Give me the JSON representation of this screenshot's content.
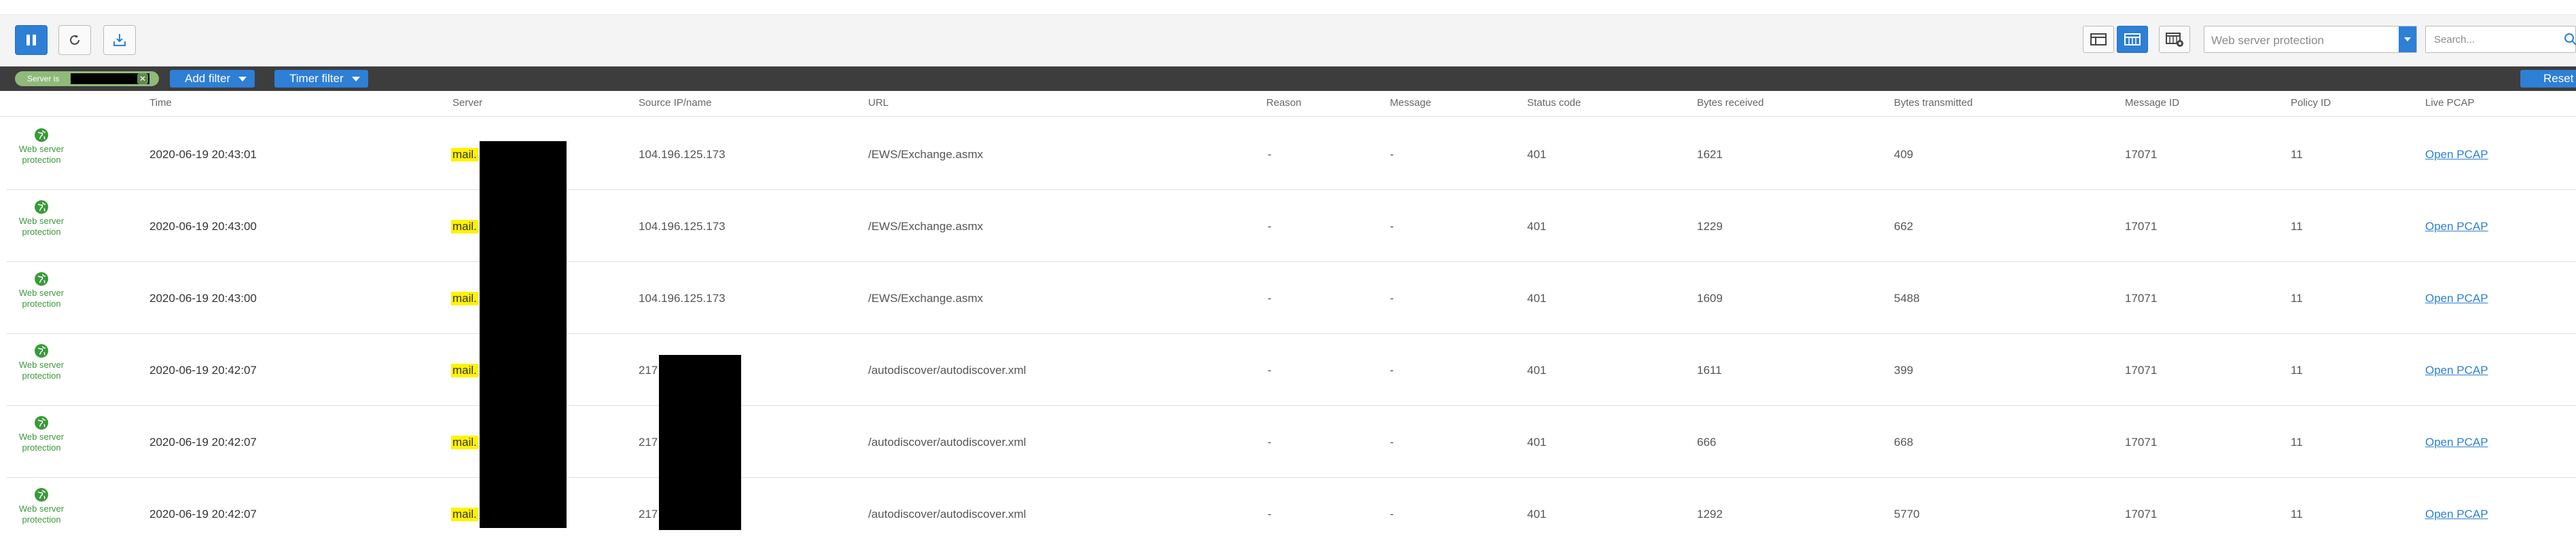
{
  "toolbar": {
    "buttons": [
      {
        "name": "pause",
        "icon": "pause-icon"
      },
      {
        "name": "refresh",
        "icon": "refresh-icon"
      },
      {
        "name": "export",
        "icon": "export-icon"
      }
    ],
    "view_buttons": [
      {
        "name": "view-detail",
        "icon": "table-layout-icon"
      },
      {
        "name": "view-grid",
        "icon": "grid-layout-icon",
        "active": true
      },
      {
        "name": "view-columns",
        "icon": "column-settings-icon"
      }
    ],
    "log_type_value": "Web server protection",
    "search_placeholder": "Search..."
  },
  "filterbar": {
    "chip_label": "Server is",
    "add_filter": "Add filter",
    "timer_filter": "Timer filter",
    "reset": "Reset"
  },
  "columns": [
    "Time",
    "Server",
    "Source IP/name",
    "URL",
    "Reason",
    "Message",
    "Status code",
    "Bytes received",
    "Bytes transmitted",
    "Message ID",
    "Policy ID",
    "Live PCAP"
  ],
  "rows": [
    {
      "type": "Web server protection",
      "time": "2020-06-19 20:43:01",
      "server": "mail.",
      "source": "104.196.125.173",
      "url": "/EWS/Exchange.asmx",
      "reason": "-",
      "message": "-",
      "status": "401",
      "bytes_received": "1621",
      "bytes_transmitted": "409",
      "message_id": "17071",
      "policy_id": "11",
      "pcap": "Open PCAP"
    },
    {
      "type": "Web server protection",
      "time": "2020-06-19 20:43:00",
      "server": "mail.",
      "source": "104.196.125.173",
      "url": "/EWS/Exchange.asmx",
      "reason": "-",
      "message": "-",
      "status": "401",
      "bytes_received": "1229",
      "bytes_transmitted": "662",
      "message_id": "17071",
      "policy_id": "11",
      "pcap": "Open PCAP"
    },
    {
      "type": "Web server protection",
      "time": "2020-06-19 20:43:00",
      "server": "mail.",
      "source": "104.196.125.173",
      "url": "/EWS/Exchange.asmx",
      "reason": "-",
      "message": "-",
      "status": "401",
      "bytes_received": "1609",
      "bytes_transmitted": "5488",
      "message_id": "17071",
      "policy_id": "11",
      "pcap": "Open PCAP"
    },
    {
      "type": "Web server protection",
      "time": "2020-06-19 20:42:07",
      "server": "mail.",
      "source": "217",
      "url": "/autodiscover/autodiscover.xml",
      "reason": "-",
      "message": "-",
      "status": "401",
      "bytes_received": "1611",
      "bytes_transmitted": "399",
      "message_id": "17071",
      "policy_id": "11",
      "pcap": "Open PCAP"
    },
    {
      "type": "Web server protection",
      "time": "2020-06-19 20:42:07",
      "server": "mail.",
      "source": "217",
      "url": "/autodiscover/autodiscover.xml",
      "reason": "-",
      "message": "-",
      "status": "401",
      "bytes_received": "666",
      "bytes_transmitted": "668",
      "message_id": "17071",
      "policy_id": "11",
      "pcap": "Open PCAP"
    },
    {
      "type": "Web server protection",
      "time": "2020-06-19 20:42:07",
      "server": "mail.",
      "source": "217",
      "url": "/autodiscover/autodiscover.xml",
      "reason": "-",
      "message": "-",
      "status": "401",
      "bytes_received": "1292",
      "bytes_transmitted": "5770",
      "message_id": "17071",
      "policy_id": "11",
      "pcap": "Open PCAP"
    }
  ],
  "colors": {
    "accent": "#2e7fd6",
    "type_green": "#3a9a3a",
    "highlight": "#fff200",
    "filterbar": "#3d3d3d"
  }
}
